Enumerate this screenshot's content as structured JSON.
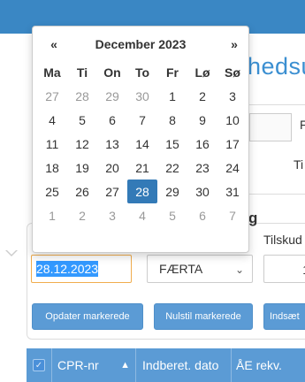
{
  "page": {
    "heading_fragment": "hedsu",
    "panel_heading_fragment": "g",
    "field_label_fragment": "Tilskud",
    "top_field_fragment": "F",
    "mid_field_fragment": "Ti"
  },
  "colors": {
    "topbar": "#3a87c4",
    "accent": "#5b9bd5",
    "selected_day": "#337ab7",
    "input_focus_border": "#f0ad4e"
  },
  "form": {
    "date_value": "28.12.2023",
    "select_value": "FÆRTA",
    "number_fragment": "1"
  },
  "buttons": {
    "update_selected": "Opdater markerede",
    "reset_selected": "Nulstil markerede",
    "insert_fragment": "Indsæt"
  },
  "table": {
    "select_all_icon": "check-icon",
    "columns": [
      "CPR-nr",
      "Indberet. dato",
      "ÅE rekv."
    ],
    "sort_icon": "sort-icon"
  },
  "datepicker": {
    "prev": "«",
    "title": "December 2023",
    "next": "»",
    "weekdays": [
      "Ma",
      "Ti",
      "On",
      "To",
      "Fr",
      "Lø",
      "Sø"
    ],
    "weeks": [
      [
        {
          "d": "27",
          "t": "old"
        },
        {
          "d": "28",
          "t": "old"
        },
        {
          "d": "29",
          "t": "old"
        },
        {
          "d": "30",
          "t": "old"
        },
        {
          "d": "1",
          "t": ""
        },
        {
          "d": "2",
          "t": ""
        },
        {
          "d": "3",
          "t": ""
        }
      ],
      [
        {
          "d": "4",
          "t": ""
        },
        {
          "d": "5",
          "t": ""
        },
        {
          "d": "6",
          "t": ""
        },
        {
          "d": "7",
          "t": ""
        },
        {
          "d": "8",
          "t": ""
        },
        {
          "d": "9",
          "t": ""
        },
        {
          "d": "10",
          "t": ""
        }
      ],
      [
        {
          "d": "11",
          "t": ""
        },
        {
          "d": "12",
          "t": ""
        },
        {
          "d": "13",
          "t": ""
        },
        {
          "d": "14",
          "t": ""
        },
        {
          "d": "15",
          "t": ""
        },
        {
          "d": "16",
          "t": ""
        },
        {
          "d": "17",
          "t": ""
        }
      ],
      [
        {
          "d": "18",
          "t": ""
        },
        {
          "d": "19",
          "t": ""
        },
        {
          "d": "20",
          "t": ""
        },
        {
          "d": "21",
          "t": ""
        },
        {
          "d": "22",
          "t": ""
        },
        {
          "d": "23",
          "t": ""
        },
        {
          "d": "24",
          "t": ""
        }
      ],
      [
        {
          "d": "25",
          "t": ""
        },
        {
          "d": "26",
          "t": ""
        },
        {
          "d": "27",
          "t": ""
        },
        {
          "d": "28",
          "t": "active"
        },
        {
          "d": "29",
          "t": ""
        },
        {
          "d": "30",
          "t": ""
        },
        {
          "d": "31",
          "t": ""
        }
      ],
      [
        {
          "d": "1",
          "t": "new"
        },
        {
          "d": "2",
          "t": "new"
        },
        {
          "d": "3",
          "t": "new"
        },
        {
          "d": "4",
          "t": "new"
        },
        {
          "d": "5",
          "t": "new"
        },
        {
          "d": "6",
          "t": "new"
        },
        {
          "d": "7",
          "t": "new"
        }
      ]
    ]
  }
}
